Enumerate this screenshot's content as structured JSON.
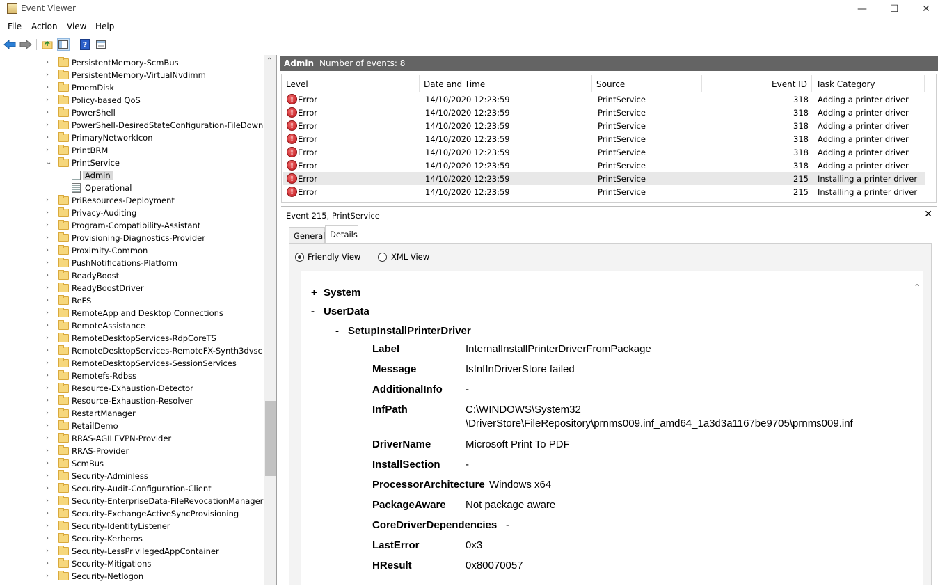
{
  "window": {
    "title": "Event Viewer",
    "minimize": "—",
    "maximize": "☐",
    "close": "✕"
  },
  "menu": [
    "File",
    "Action",
    "View",
    "Help"
  ],
  "tree": {
    "items": [
      {
        "label": "PersistentMemory-ScmBus",
        "type": "folder"
      },
      {
        "label": "PersistentMemory-VirtualNvdimm",
        "type": "folder"
      },
      {
        "label": "PmemDisk",
        "type": "folder"
      },
      {
        "label": "Policy-based QoS",
        "type": "folder"
      },
      {
        "label": "PowerShell",
        "type": "folder"
      },
      {
        "label": "PowerShell-DesiredStateConfiguration-FileDownloadManager",
        "type": "folder"
      },
      {
        "label": "PrimaryNetworkIcon",
        "type": "folder"
      },
      {
        "label": "PrintBRM",
        "type": "folder"
      },
      {
        "label": "PrintService",
        "type": "folder-open"
      },
      {
        "label": "Admin",
        "type": "log",
        "selected": true
      },
      {
        "label": "Operational",
        "type": "log"
      },
      {
        "label": "PriResources-Deployment",
        "type": "folder"
      },
      {
        "label": "Privacy-Auditing",
        "type": "folder"
      },
      {
        "label": "Program-Compatibility-Assistant",
        "type": "folder"
      },
      {
        "label": "Provisioning-Diagnostics-Provider",
        "type": "folder"
      },
      {
        "label": "Proximity-Common",
        "type": "folder"
      },
      {
        "label": "PushNotifications-Platform",
        "type": "folder"
      },
      {
        "label": "ReadyBoost",
        "type": "folder"
      },
      {
        "label": "ReadyBoostDriver",
        "type": "folder"
      },
      {
        "label": "ReFS",
        "type": "folder"
      },
      {
        "label": "RemoteApp and Desktop Connections",
        "type": "folder"
      },
      {
        "label": "RemoteAssistance",
        "type": "folder"
      },
      {
        "label": "RemoteDesktopServices-RdpCoreTS",
        "type": "folder"
      },
      {
        "label": "RemoteDesktopServices-RemoteFX-Synth3dvsc",
        "type": "folder"
      },
      {
        "label": "RemoteDesktopServices-SessionServices",
        "type": "folder"
      },
      {
        "label": "Remotefs-Rdbss",
        "type": "folder"
      },
      {
        "label": "Resource-Exhaustion-Detector",
        "type": "folder"
      },
      {
        "label": "Resource-Exhaustion-Resolver",
        "type": "folder"
      },
      {
        "label": "RestartManager",
        "type": "folder"
      },
      {
        "label": "RetailDemo",
        "type": "folder"
      },
      {
        "label": "RRAS-AGILEVPN-Provider",
        "type": "folder"
      },
      {
        "label": "RRAS-Provider",
        "type": "folder"
      },
      {
        "label": "ScmBus",
        "type": "folder"
      },
      {
        "label": "Security-Adminless",
        "type": "folder"
      },
      {
        "label": "Security-Audit-Configuration-Client",
        "type": "folder"
      },
      {
        "label": "Security-EnterpriseData-FileRevocationManager",
        "type": "folder"
      },
      {
        "label": "Security-ExchangeActiveSyncProvisioning",
        "type": "folder"
      },
      {
        "label": "Security-IdentityListener",
        "type": "folder"
      },
      {
        "label": "Security-Kerberos",
        "type": "folder"
      },
      {
        "label": "Security-LessPrivilegedAppContainer",
        "type": "folder"
      },
      {
        "label": "Security-Mitigations",
        "type": "folder"
      },
      {
        "label": "Security-Netlogon",
        "type": "folder"
      }
    ]
  },
  "log_header": {
    "name": "Admin",
    "count_text": "Number of events: 8"
  },
  "columns": [
    "Level",
    "Date and Time",
    "Source",
    "Event ID",
    "Task Category"
  ],
  "events": [
    {
      "level": "Error",
      "datetime": "14/10/2020 12:23:59",
      "source": "PrintService",
      "event_id": "318",
      "category": "Adding a printer driver"
    },
    {
      "level": "Error",
      "datetime": "14/10/2020 12:23:59",
      "source": "PrintService",
      "event_id": "318",
      "category": "Adding a printer driver"
    },
    {
      "level": "Error",
      "datetime": "14/10/2020 12:23:59",
      "source": "PrintService",
      "event_id": "318",
      "category": "Adding a printer driver"
    },
    {
      "level": "Error",
      "datetime": "14/10/2020 12:23:59",
      "source": "PrintService",
      "event_id": "318",
      "category": "Adding a printer driver"
    },
    {
      "level": "Error",
      "datetime": "14/10/2020 12:23:59",
      "source": "PrintService",
      "event_id": "318",
      "category": "Adding a printer driver"
    },
    {
      "level": "Error",
      "datetime": "14/10/2020 12:23:59",
      "source": "PrintService",
      "event_id": "318",
      "category": "Adding a printer driver"
    },
    {
      "level": "Error",
      "datetime": "14/10/2020 12:23:59",
      "source": "PrintService",
      "event_id": "215",
      "category": "Installing a printer driver",
      "selected": true
    },
    {
      "level": "Error",
      "datetime": "14/10/2020 12:23:59",
      "source": "PrintService",
      "event_id": "215",
      "category": "Installing a printer driver"
    }
  ],
  "detail": {
    "title": "Event 215, PrintService",
    "close": "✕",
    "tabs": [
      "General",
      "Details"
    ],
    "active_tab": "Details",
    "views": {
      "friendly": "Friendly View",
      "xml": "XML View",
      "selected": "friendly"
    },
    "system": {
      "toggle": "+",
      "label": "System"
    },
    "userdata": {
      "toggle": "-",
      "label": "UserData"
    },
    "setup": {
      "toggle": "-",
      "label": "SetupInstallPrinterDriver"
    },
    "fields": [
      {
        "key": "Label",
        "value": "InternalInstallPrinterDriverFromPackage"
      },
      {
        "key": "Message",
        "value": "IsInfInDriverStore failed"
      },
      {
        "key": "AdditionalInfo",
        "value": "-"
      },
      {
        "key": "InfPath",
        "value": "C:\\WINDOWS\\System32",
        "value2": "\\DriverStore\\FileRepository\\prnms009.inf_amd64_1a3d3a1167be9705\\prnms009.inf"
      },
      {
        "key": "DriverName",
        "value": "Microsoft Print To PDF"
      },
      {
        "key": "InstallSection",
        "value": "-"
      },
      {
        "key": "ProcessorArchitecture",
        "value": "Windows x64"
      },
      {
        "key": "PackageAware",
        "value": "Not package aware"
      },
      {
        "key": "CoreDriverDependencies",
        "value": "-"
      },
      {
        "key": "LastError",
        "value": "0x3"
      },
      {
        "key": "HResult",
        "value": "0x80070057"
      }
    ]
  }
}
